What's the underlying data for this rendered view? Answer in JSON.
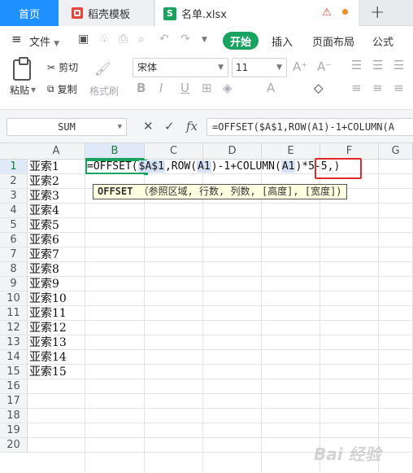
{
  "tabs": {
    "home": "首页",
    "template": "稻壳模板",
    "file": "名单.xlsx",
    "file_icon_letter": "S"
  },
  "menu": {
    "file": "文件",
    "start": "开始",
    "insert": "插入",
    "page_layout": "页面布局",
    "formula": "公式"
  },
  "ribbon": {
    "paste": "粘贴",
    "cut": "剪切",
    "copy": "复制",
    "format_painter": "格式刷",
    "font_name": "宋体",
    "font_size": "11"
  },
  "formula_bar": {
    "name_box": "SUM",
    "fx": "fx",
    "content": "=OFFSET($A$1,ROW(A1)-1+COLUMN(A"
  },
  "grid": {
    "columns": [
      "A",
      "B",
      "C",
      "D",
      "E",
      "F",
      "G"
    ],
    "active_column": "B",
    "rows": [
      "1",
      "2",
      "3",
      "4",
      "5",
      "6",
      "7",
      "8",
      "9",
      "10",
      "11",
      "12",
      "13",
      "14",
      "15",
      "16",
      "17",
      "18",
      "19",
      "20"
    ],
    "column_a": [
      "亚索1",
      "亚索2",
      "亚索3",
      "亚索4",
      "亚索5",
      "亚索6",
      "亚索7",
      "亚索8",
      "亚索9",
      "亚索10",
      "亚索11",
      "亚索12",
      "亚索13",
      "亚索14",
      "亚索15"
    ]
  },
  "editing": {
    "part1": "=OFFSET(",
    "ref1": "$A$1",
    "part2": ",ROW(",
    "ref2": "A1",
    "part3": ")-1+COLUMN(",
    "ref3": "A1",
    "part4": ")",
    "part5": "*5-5,)"
  },
  "tooltip": {
    "func": "OFFSET",
    "args": "（参照区域, 行数, 列数, [高度], [宽度])"
  },
  "watermark": "Bai 经验"
}
